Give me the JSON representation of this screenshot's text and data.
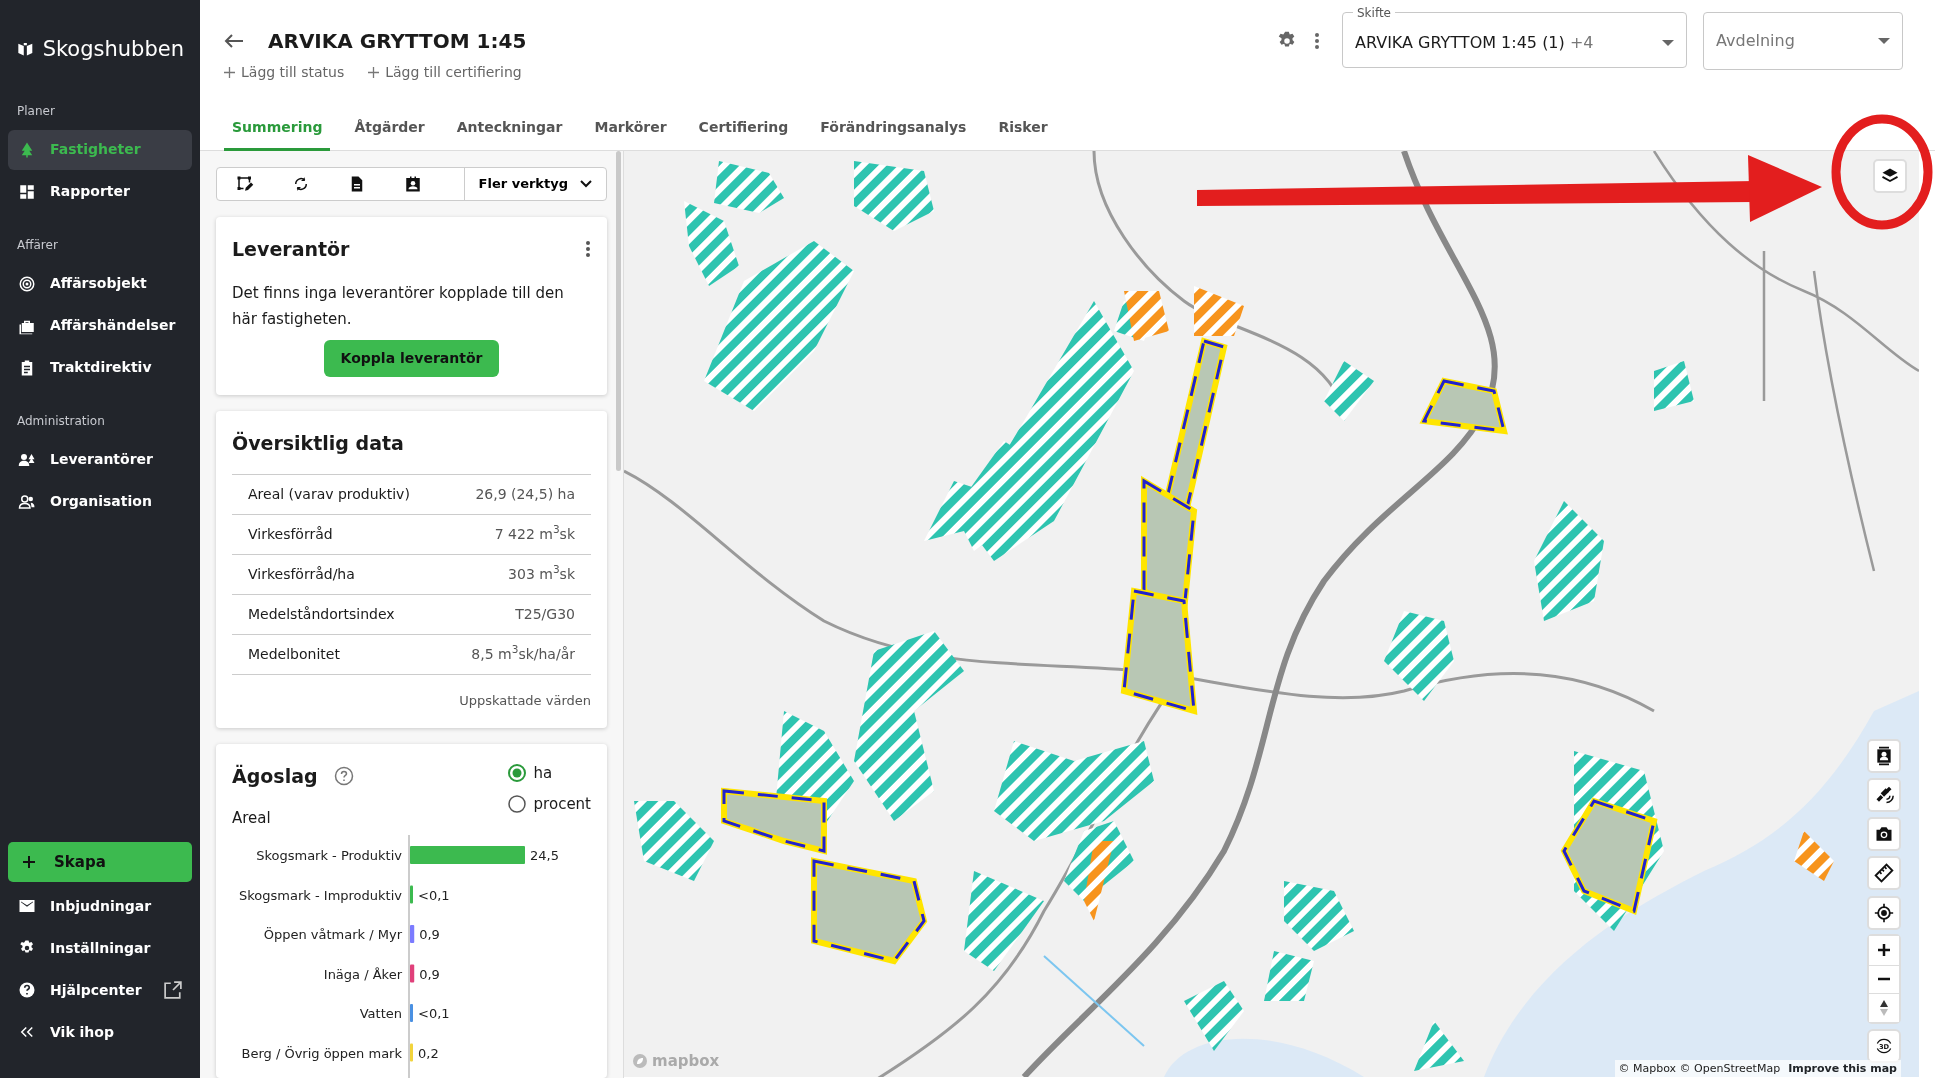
{
  "sidebar": {
    "logo": "Skogshubben",
    "sections": [
      {
        "heading": "Planer",
        "items": [
          {
            "label": "Fastigheter",
            "selected": true
          },
          {
            "label": "Rapporter",
            "selected": false
          }
        ]
      },
      {
        "heading": "Affärer",
        "items": [
          {
            "label": "Affärsobjekt",
            "selected": false
          },
          {
            "label": "Affärshändelser",
            "selected": false
          },
          {
            "label": "Traktdirektiv",
            "selected": false
          }
        ]
      },
      {
        "heading": "Administration",
        "items": [
          {
            "label": "Leverantörer",
            "selected": false
          },
          {
            "label": "Organisation",
            "selected": false
          }
        ]
      }
    ],
    "create_button": "Skapa",
    "bottom_items": [
      {
        "label": "Inbjudningar",
        "external": false
      },
      {
        "label": "Inställningar",
        "external": false
      },
      {
        "label": "Hjälpcenter",
        "external": true
      },
      {
        "label": "Vik ihop",
        "external": false
      }
    ]
  },
  "header": {
    "title": "ARVIKA GRYTTOM 1:45",
    "actions": [
      "Lägg till status",
      "Lägg till certifiering"
    ],
    "skifte": {
      "label": "Skifte",
      "value": "ARVIKA GRYTTOM 1:45 (1)",
      "extra": "+4"
    },
    "avdelning": {
      "placeholder": "Avdelning"
    }
  },
  "tabs": [
    {
      "label": "Summering",
      "selected": true
    },
    {
      "label": "Åtgärder",
      "selected": false
    },
    {
      "label": "Anteckningar",
      "selected": false
    },
    {
      "label": "Markörer",
      "selected": false
    },
    {
      "label": "Certifiering",
      "selected": false
    },
    {
      "label": "Förändringsanalys",
      "selected": false
    },
    {
      "label": "Risker",
      "selected": false
    }
  ],
  "toolbar": {
    "more_tools": "Fler verktyg"
  },
  "supplier_card": {
    "title": "Leverantör",
    "message": "Det finns inga leverantörer kopplade till den här fastigheten.",
    "button": "Koppla leverantör"
  },
  "overview": {
    "title": "Översiktlig data",
    "rows": [
      {
        "label": "Areal (varav produktiv)",
        "value": "26,9 (24,5) ha"
      },
      {
        "label": "Virkesförråd",
        "value": "7 422 m$^{3}$sk"
      },
      {
        "label": "Virkesförråd/ha",
        "value": "303 m$^{3}$sk"
      },
      {
        "label": "Medelståndortsindex",
        "value": "T25/G30"
      },
      {
        "label": "Medelbonitet",
        "value": "8,5 m$^{3}$sk/ha/år"
      }
    ],
    "footnote": "Uppskattade värden"
  },
  "land_use": {
    "title": "Ägoslag",
    "subtitle": "Areal",
    "units": [
      {
        "label": "ha",
        "selected": true
      },
      {
        "label": "procent",
        "selected": false
      }
    ],
    "chart_data": {
      "type": "bar",
      "orientation": "horizontal",
      "categories": [
        "Skogsmark - Produktiv",
        "Skogsmark - Improduktiv",
        "Öppen våtmark / Myr",
        "Inäga / Åker",
        "Vatten",
        "Berg / Övrig öppen mark"
      ],
      "values": [
        24.5,
        0.05,
        0.9,
        0.9,
        0.05,
        0.2
      ],
      "value_labels": [
        "24,5",
        "<0,1",
        "0,9",
        "0,9",
        "<0,1",
        "0,2"
      ]
    }
  },
  "map": {
    "logo": "mapbox",
    "three_d_label": "3D",
    "attribution": "© Mapbox © OpenStreetMap",
    "improve_link": "Improve this map"
  }
}
